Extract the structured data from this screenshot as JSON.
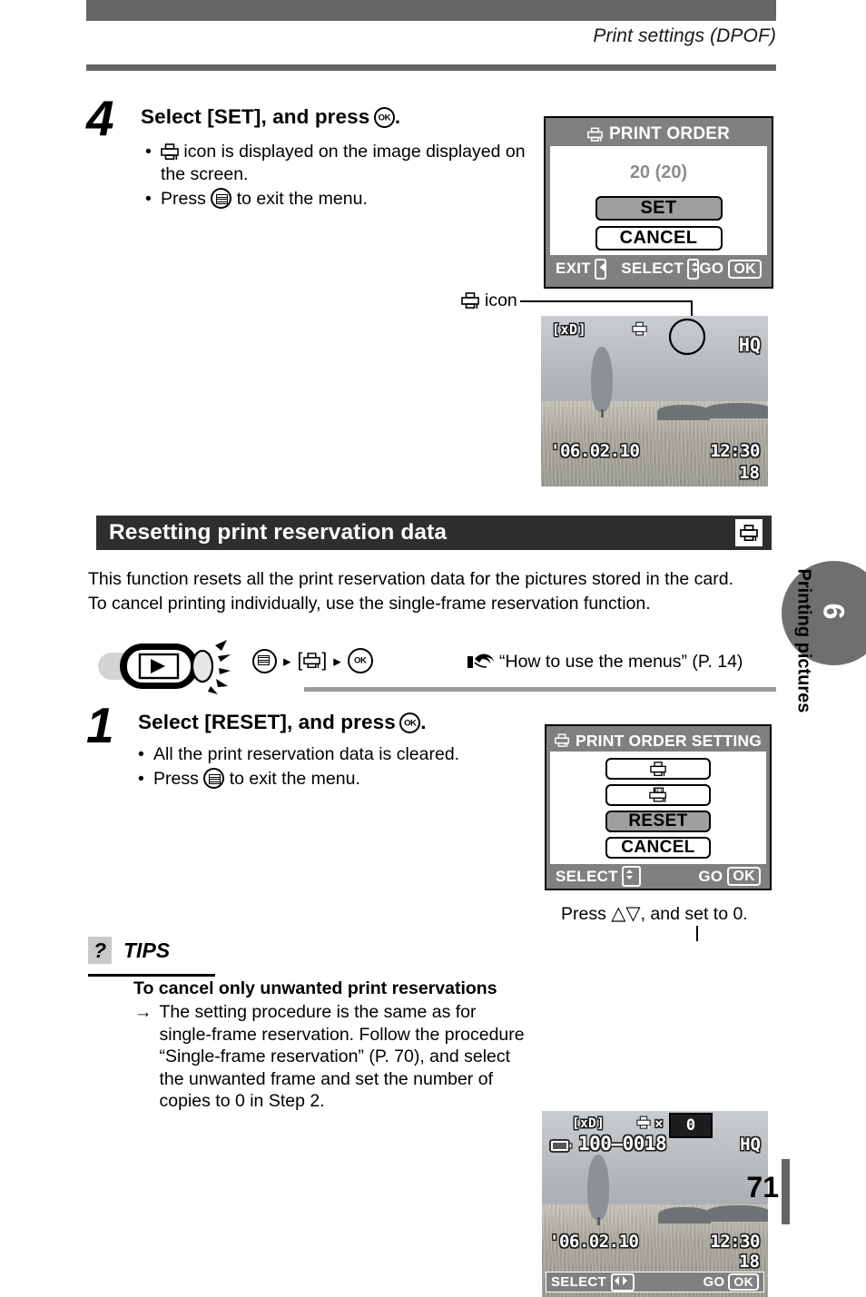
{
  "header": {
    "title": "Print settings (DPOF)"
  },
  "step4": {
    "number": "4",
    "title_before": "Select [SET], and press",
    "title_after": ".",
    "bullets": [
      {
        "marker": "•",
        "icon": "print-icon",
        "text": "icon is displayed on the image displayed on the screen."
      },
      {
        "marker": "•",
        "pre": "Press",
        "icon": "menu-icon",
        "text": "to exit the menu."
      }
    ]
  },
  "lcd_print_order": {
    "title": "PRINT ORDER",
    "title_icon": "print-icon",
    "count": "20 (20)",
    "buttons": [
      {
        "label": "SET",
        "selected": true
      },
      {
        "label": "CANCEL",
        "selected": false
      }
    ],
    "bar": {
      "exit_label": "EXIT",
      "select_label": "SELECT",
      "go_label": "GO",
      "ok_label": "OK"
    }
  },
  "callout_icon": {
    "label": "icon",
    "icon": "print-icon"
  },
  "photo_top": {
    "card": "[xD]",
    "print_icon": "print-icon",
    "quality": "HQ",
    "date": "'06.02.10",
    "time": "12:30",
    "frame": "18"
  },
  "section": {
    "title": "Resetting print reservation data",
    "icon": "print-icon",
    "intro_line1": "This function resets all the print reservation data for the pictures stored in the card.",
    "intro_line2": "To cancel printing individually, use the single-frame reservation function."
  },
  "nav": {
    "mode_icon": "playback-mode-icon",
    "menu_icon": "menu-icon",
    "arrow1": "▸",
    "bracket_item": "[⎙]",
    "arrow2": "▸",
    "ok_icon": "ok-icon",
    "pointer_icon": "pointing-hand-icon",
    "reference": "“How to use the menus” (P. 14)"
  },
  "step1": {
    "number": "1",
    "title_before": "Select [RESET], and press",
    "title_after": ".",
    "bullets": [
      {
        "marker": "•",
        "text": "All the print reservation data is cleared."
      },
      {
        "marker": "•",
        "pre": "Press",
        "icon": "menu-icon",
        "text": "to exit the menu."
      }
    ]
  },
  "lcd_print_order_setting": {
    "title": "PRINT ORDER SETTING",
    "title_icon": "print-icon",
    "buttons": [
      {
        "label": "",
        "icon": "print-single-icon",
        "selected": false
      },
      {
        "label": "",
        "icon": "print-all-icon",
        "selected": false
      },
      {
        "label": "RESET",
        "selected": true
      },
      {
        "label": "CANCEL",
        "selected": false
      }
    ],
    "bar": {
      "select_label": "SELECT",
      "go_label": "GO",
      "ok_label": "OK"
    }
  },
  "caption_press": {
    "text_before": "Press",
    "arrows": "△▽",
    "text_after": ", and set to 0."
  },
  "photo_bottom": {
    "card": "[xD]",
    "print_icon": "print-icon",
    "multiply": "×",
    "copies": "0",
    "battery_icon": "battery-icon",
    "file_number": "100–0018",
    "quality": "HQ",
    "date": "'06.02.10",
    "time": "12:30",
    "frame": "18",
    "bar": {
      "select_label": "SELECT",
      "go_label": "GO",
      "ok_label": "OK"
    }
  },
  "tips": {
    "badge": "?",
    "heading": "TIPS",
    "subheading": "To cancel only unwanted print reservations",
    "arrow": "→",
    "body": "The setting procedure is the same as for single-frame reservation. Follow the procedure “Single-frame reservation” (P. 70), and select the unwanted frame and set the number of copies to 0 in Step 2."
  },
  "side_tab": {
    "number": "6",
    "label": "Printing pictures"
  },
  "footer": {
    "page_number": "71"
  },
  "colors": {
    "band": "#2e2e2e",
    "rule": "#656565",
    "lcd_gray": "#808080",
    "selected": "#9f9f9f",
    "tab": "#6f6f6f"
  }
}
